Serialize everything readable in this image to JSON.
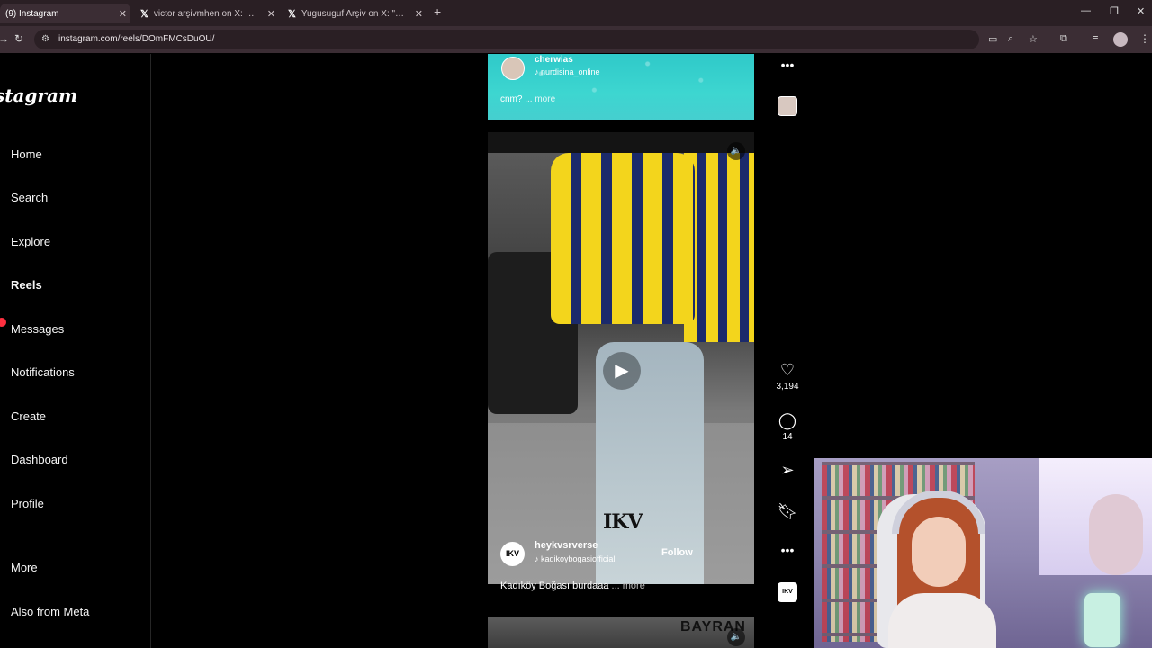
{
  "browser": {
    "tabs": [
      {
        "title": "(9) Instagram",
        "close": "✕"
      },
      {
        "title": "victor arşivmhen on X: \"Wilfred",
        "close": "✕"
      },
      {
        "title": "Yugusuguf Arşiv on X: \"şanlıurfa",
        "close": "✕"
      }
    ],
    "new_tab": "+",
    "url": "instagram.com/reels/DOmFMCsDuOU/",
    "window_controls": {
      "minimize": "—",
      "restore": "❐",
      "close": "✕"
    }
  },
  "sidebar": {
    "logo": "stagram",
    "items": [
      {
        "label": "Home"
      },
      {
        "label": "Search"
      },
      {
        "label": "Explore"
      },
      {
        "label": "Reels"
      },
      {
        "label": "Messages"
      },
      {
        "label": "Notifications"
      },
      {
        "label": "Create"
      },
      {
        "label": "Dashboard"
      },
      {
        "label": "Profile"
      },
      {
        "label": "More"
      },
      {
        "label": "Also from Meta"
      }
    ]
  },
  "reel_top": {
    "username": "cherwias",
    "audio": "nurdisina_online",
    "caption": "cnm?",
    "more": "... more"
  },
  "reel_main": {
    "watermark": "IKV",
    "username": "heykvsrverse",
    "audio": "kadikoybogasiofficiall",
    "follow": "Follow",
    "caption": "Kadıköy Boğası burdaaa",
    "more": "... more",
    "avatar_text": "IKV"
  },
  "reel_next": {
    "overlay_text": "BAYRAN"
  },
  "actions": {
    "likes": "3,194",
    "comments": "14"
  },
  "icons": {
    "heart": "heart-icon",
    "comment": "comment-icon",
    "share": "share-icon",
    "save": "bookmark-icon",
    "more": "more-icon",
    "mute": "speaker-icon",
    "play": "play-icon"
  },
  "colors": {
    "notification_badge": "#ff3040",
    "tab_bar": "#2a1f24",
    "address_bar": "#3b2d34"
  }
}
